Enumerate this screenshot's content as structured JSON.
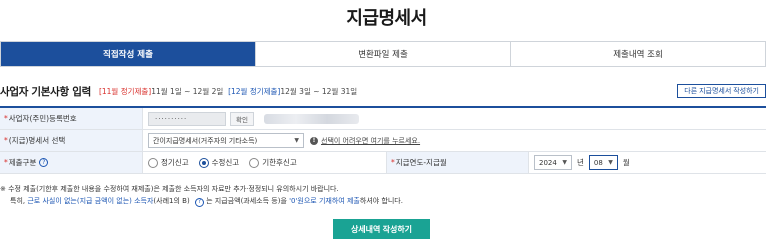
{
  "page": {
    "title": "지급명세서"
  },
  "tabs": [
    {
      "label": "직접작성 제출",
      "active": true
    },
    {
      "label": "변환파일 제출",
      "active": false
    },
    {
      "label": "제출내역 조회",
      "active": false
    }
  ],
  "section": {
    "title": "사업자 기본사항 입력",
    "period1_tag": "[11월 정기제출]",
    "period1_range": "11월 1일 ~ 12월 2일",
    "period2_tag": "[12월 정기제출]",
    "period2_range": "12월 3일 ~ 12월 31일",
    "other_button": "다른 지급명세서 작성하기"
  },
  "form": {
    "business_number": {
      "label": "사업자(주민)등록번호",
      "required_mark": "*",
      "masked_value": "··········",
      "check_button": "확인"
    },
    "statement_type": {
      "label": "(지급)명세서 선택",
      "required_mark": "*",
      "selected": "간이지급명세서(거주자의 기타소득)",
      "hint": "선택이 어려우면 여기를 누르세요."
    },
    "submission_type": {
      "label": "제출구분",
      "required_mark": "*",
      "options": [
        "정기신고",
        "수정신고",
        "기한후신고"
      ],
      "selected_index": 1
    },
    "payment_period": {
      "label": "지급연도-지급월",
      "required_mark": "*",
      "year": "2024",
      "year_unit": "년",
      "month": "08",
      "month_unit": "월"
    }
  },
  "notes": {
    "line1": "※ 수정 제출(기한후 제출한 내용을 수정하여 재제출)은 제출한 소득자의 자료만 추가·정정되니 유의하시기 바랍니다.",
    "line2_a": "특히, ",
    "line2_b": "근로 사실이 없는(지급 금액이 없는) 소득자",
    "line2_c": "(사례1의 B) ",
    "line2_d": " 는 지급금액(과세소득 등)을 ",
    "line2_e": "'0'원으로 기재하여 제출",
    "line2_f": "하셔야 합니다."
  },
  "submit_button": "상세내역 작성하기",
  "colors": {
    "primary": "#1c4f9c",
    "accent_teal": "#1aa394",
    "alert_red": "#d9302c"
  }
}
